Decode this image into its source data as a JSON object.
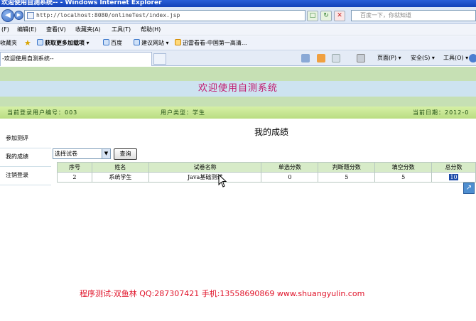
{
  "window": {
    "title": "欢迎使用自测系统-- - Windows Internet Explorer"
  },
  "address_bar": {
    "url": "http://localhost:8080/onlineTest/index.jsp",
    "search_placeholder": "百度一下，你就知道"
  },
  "menu": [
    {
      "label": "(F)"
    },
    {
      "label": "编辑(E)"
    },
    {
      "label": "查看(V)"
    },
    {
      "label": "收藏夹(A)"
    },
    {
      "label": "工具(T)"
    },
    {
      "label": "帮助(H)"
    }
  ],
  "favorites_bar": {
    "label": "收藏夹",
    "items": [
      {
        "label": "获取更多加载项"
      },
      {
        "label": "百度"
      },
      {
        "label": "建议网站"
      },
      {
        "label": "迅雷看看-中国第一高清..."
      }
    ]
  },
  "tab": {
    "title": "-欢迎使用自测系统--"
  },
  "command_bar": {
    "page_label": "页面(P)",
    "safety_label": "安全(S)",
    "tools_label": "工具(O)"
  },
  "page": {
    "header_title": "欢迎使用自测系统",
    "info": {
      "user_id": "当前登录用户编号：003",
      "user_type": "用户类型：学生",
      "current_date": "当前日期：2012-0"
    },
    "sidebar": [
      {
        "label": "参加测评"
      },
      {
        "label": "我的成绩"
      },
      {
        "label": "注销登录"
      }
    ],
    "results_title": "我的成绩",
    "exam_select": {
      "value": "选择试卷"
    },
    "query_button": "查询",
    "table": {
      "headers": [
        "序号",
        "姓名",
        "试卷名称",
        "单选分数",
        "判断题分数",
        "填空分数",
        "总分数"
      ],
      "rows": [
        {
          "no": "2",
          "name": "系统学生",
          "exam": "Java基础测试",
          "single": "0",
          "judge": "5",
          "blank": "5",
          "total": "10"
        }
      ]
    },
    "footer_watermark": "程序测试:双鱼林 QQ:287307421 手机:13558690869 www.shuangyulin.com"
  },
  "colors": {
    "title_pink": "#c2186e",
    "watermark_red": "#e0142a",
    "header_green": "#c6e0b4",
    "header_blue": "#cde3f0"
  }
}
